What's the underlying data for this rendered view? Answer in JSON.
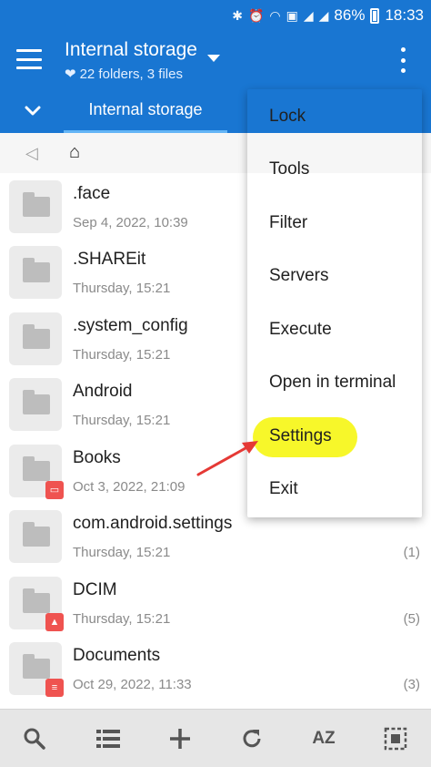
{
  "status_bar": {
    "battery": "86%",
    "time": "18:33"
  },
  "app_bar": {
    "title": "Internal storage",
    "subtitle": "22 folders, 3 files"
  },
  "tab": {
    "label": "Internal storage"
  },
  "breadcrumb": {
    "back": "◁",
    "home": "⌂"
  },
  "files": [
    {
      "name": ".face",
      "date": "Sep 4, 2022, 10:39",
      "count": "",
      "badge": ""
    },
    {
      "name": ".SHAREit",
      "date": "Thursday, 15:21",
      "count": "",
      "badge": ""
    },
    {
      "name": ".system_config",
      "date": "Thursday, 15:21",
      "count": "",
      "badge": ""
    },
    {
      "name": "Android",
      "date": "Thursday, 15:21",
      "count": "",
      "badge": ""
    },
    {
      "name": "Books",
      "date": "Oct 3, 2022, 21:09",
      "count": "",
      "badge": "book-icon"
    },
    {
      "name": "com.android.settings",
      "date": "Thursday, 15:21",
      "count": "(1)",
      "badge": ""
    },
    {
      "name": "DCIM",
      "date": "Thursday, 15:21",
      "count": "(5)",
      "badge": "image-icon"
    },
    {
      "name": "Documents",
      "date": "Oct 29, 2022, 11:33",
      "count": "(3)",
      "badge": "document-icon"
    }
  ],
  "menu": {
    "items": [
      "Lock",
      "Tools",
      "Filter",
      "Servers",
      "Execute",
      "Open in terminal",
      "Settings",
      "Exit"
    ],
    "highlighted": "Settings"
  },
  "bottom_bar": {
    "sort_label": "AZ"
  },
  "colors": {
    "primary": "#1976d2",
    "highlight": "#f7f72a",
    "arrow": "#e53935"
  }
}
